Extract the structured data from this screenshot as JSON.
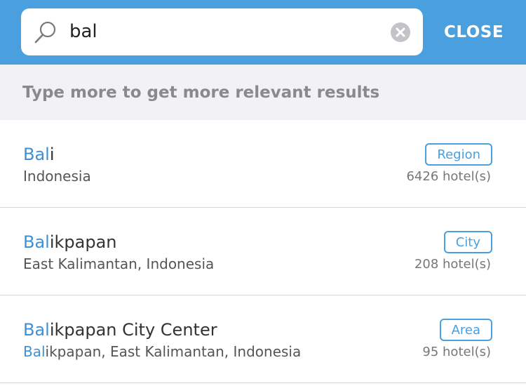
{
  "search": {
    "query": "bal",
    "close_label": "CLOSE"
  },
  "hint": "Type more to get more relevant results",
  "results": [
    {
      "name_highlight": "Bal",
      "name_rest": "i",
      "location_highlight": "",
      "location_rest": "Indonesia",
      "type": "Region",
      "count": "6426 hotel(s)"
    },
    {
      "name_highlight": "Bal",
      "name_rest": "ikpapan",
      "location_highlight": "",
      "location_rest": "East Kalimantan, Indonesia",
      "type": "City",
      "count": "208 hotel(s)"
    },
    {
      "name_highlight": "Bal",
      "name_rest": "ikpapan City Center",
      "location_highlight": "Bal",
      "location_rest": "ikpapan, East Kalimantan, Indonesia",
      "type": "Area",
      "count": "95 hotel(s)"
    }
  ],
  "colors": {
    "header": "#4a9fde",
    "highlight": "#3d8fd6",
    "hint_bg": "#f2f2f4"
  },
  "icons": {
    "search": "search-icon",
    "clear": "clear-icon"
  }
}
